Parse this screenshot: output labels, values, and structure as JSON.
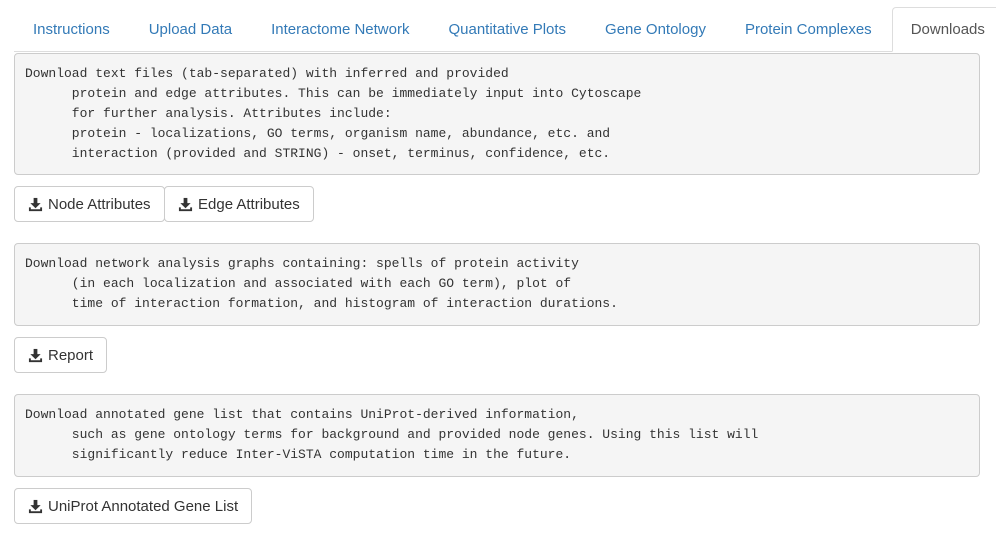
{
  "tabs": [
    {
      "label": "Instructions",
      "active": false
    },
    {
      "label": "Upload Data",
      "active": false
    },
    {
      "label": "Interactome Network",
      "active": false
    },
    {
      "label": "Quantitative Plots",
      "active": false
    },
    {
      "label": "Gene Ontology",
      "active": false
    },
    {
      "label": "Protein Complexes",
      "active": false
    },
    {
      "label": "Downloads",
      "active": true
    }
  ],
  "sections": {
    "attributes": {
      "text": "Download text files (tab-separated) with inferred and provided\n      protein and edge attributes. This can be immediately input into Cytoscape\n      for further analysis. Attributes include:\n      protein - localizations, GO terms, organism name, abundance, etc. and\n      interaction (provided and STRING) - onset, terminus, confidence, etc.",
      "node_button": "Node Attributes",
      "edge_button": "Edge Attributes"
    },
    "report": {
      "text": "Download network analysis graphs containing: spells of protein activity\n      (in each localization and associated with each GO term), plot of\n      time of interaction formation, and histogram of interaction durations.",
      "button": "Report"
    },
    "genelist": {
      "text": "Download annotated gene list that contains UniProt-derived information,\n      such as gene ontology terms for background and provided node genes. Using this list will\n      significantly reduce Inter-ViSTA computation time in the future.",
      "button": "UniProt Annotated Gene List"
    }
  },
  "icons": {
    "download": "download-icon"
  }
}
